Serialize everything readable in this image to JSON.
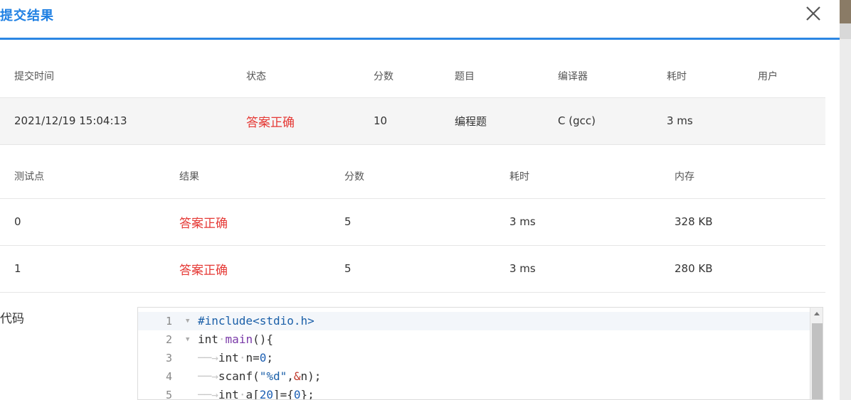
{
  "dialog": {
    "title": "提交结果",
    "close_icon": "close-icon"
  },
  "summary": {
    "headers": [
      "提交时间",
      "状态",
      "分数",
      "题目",
      "编译器",
      "耗时",
      "用户"
    ],
    "row": {
      "time": "2021/12/19 15:04:13",
      "status": "答案正确",
      "score": "10",
      "problem": "编程题",
      "compiler": "C (gcc)",
      "duration": "3 ms",
      "user": ""
    }
  },
  "testcases": {
    "headers": [
      "测试点",
      "结果",
      "分数",
      "耗时",
      "内存"
    ],
    "rows": [
      {
        "id": "0",
        "result": "答案正确",
        "score": "5",
        "duration": "3 ms",
        "memory": "328 KB"
      },
      {
        "id": "1",
        "result": "答案正确",
        "score": "5",
        "duration": "3 ms",
        "memory": "280 KB"
      }
    ]
  },
  "code": {
    "label": "代码",
    "lines": [
      {
        "n": "1",
        "text": "#include<stdio.h>"
      },
      {
        "n": "2",
        "text": "int main(){"
      },
      {
        "n": "3",
        "text": "int n=0;"
      },
      {
        "n": "4",
        "text": "scanf(\"%d\",&n);"
      },
      {
        "n": "5",
        "text": "int a[20]={0};"
      }
    ]
  },
  "colors": {
    "accent": "#2b86e3",
    "success_text": "#e53935"
  }
}
